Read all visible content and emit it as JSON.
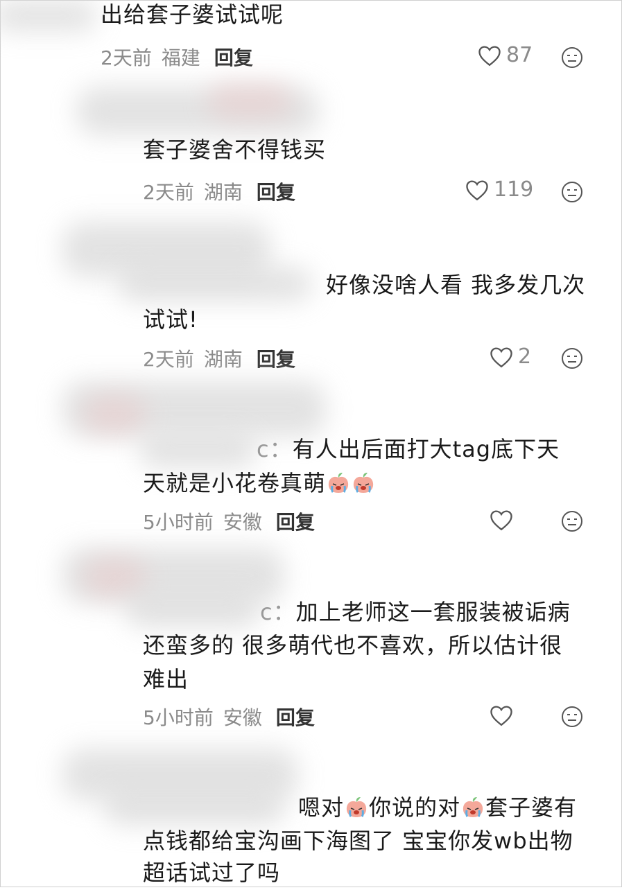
{
  "comments": [
    {
      "text": "出给套子婆试试呢",
      "time": "2天前",
      "region": "福建",
      "reply": "回复",
      "likes": "87"
    },
    {
      "text": "套子婆舍不得钱买",
      "time": "2天前",
      "region": "湖南",
      "reply": "回复",
      "likes": "119"
    },
    {
      "line1": "好像没啥人看 我多发几次",
      "line2": "试试!",
      "time": "2天前",
      "region": "湖南",
      "reply": "回复",
      "likes": "2"
    },
    {
      "line1": "有人出后面打大tag底下天",
      "line2": "天就是小花卷真萌",
      "time": "5小时前",
      "region": "安徽",
      "reply": "回复",
      "likes": ""
    },
    {
      "line1": "加上老师这一套服装被诟病",
      "line2": "还蛮多的 很多萌代也不喜欢，所以估计很",
      "line3": "难出",
      "time": "5小时前",
      "region": "安徽",
      "reply": "回复",
      "likes": ""
    },
    {
      "seg1": "嗯对",
      "seg2": "你说的对",
      "seg3": "套子婆有",
      "line2": "点钱都给宝沟画下海图了 宝宝你发wb出物",
      "line3": "超话试过了吗"
    }
  ],
  "fragments": {
    "c4_prefix": "c：",
    "c5_prefix": "c："
  },
  "icons": {
    "like": "heart-outline-icon",
    "reaction": "emoji-face-icon",
    "sticker": "crying-peach-emoji"
  }
}
